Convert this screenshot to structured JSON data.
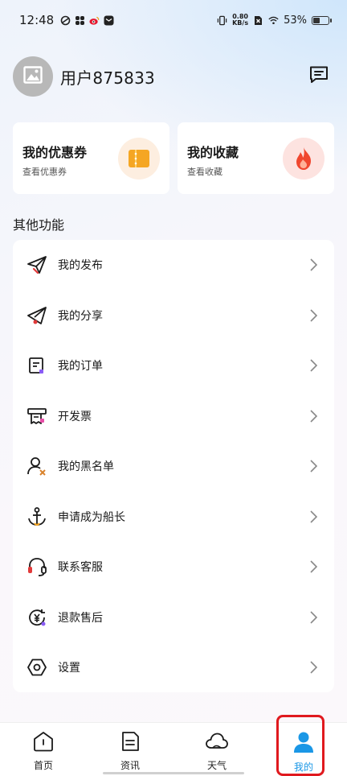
{
  "status_bar": {
    "time": "12:48",
    "net_speed_value": "0.80",
    "net_speed_unit": "KB/s",
    "battery_percent": "53%",
    "battery_level": 0.53,
    "left_icons": [
      "sync-icon",
      "pinwheel-icon",
      "weibo-icon",
      "message-app-icon"
    ],
    "right_icons": [
      "vibrate-icon",
      "no-sim-icon",
      "wifi-icon",
      "battery-icon"
    ]
  },
  "profile": {
    "username": "用户875833",
    "avatar_icon": "image-placeholder-icon",
    "message_icon": "message-icon"
  },
  "cards": [
    {
      "title": "我的优惠券",
      "subtitle": "查看优惠券",
      "icon": "coupon-icon",
      "color": "#f5a623"
    },
    {
      "title": "我的收藏",
      "subtitle": "查看收藏",
      "icon": "flame-icon",
      "color": "#f0472f"
    }
  ],
  "section_title": "其他功能",
  "menu": [
    {
      "label": "我的发布",
      "icon": "paper-plane-icon"
    },
    {
      "label": "我的分享",
      "icon": "share-plane-icon"
    },
    {
      "label": "我的订单",
      "icon": "order-list-icon"
    },
    {
      "label": "开发票",
      "icon": "invoice-icon"
    },
    {
      "label": "我的黑名单",
      "icon": "user-block-icon"
    },
    {
      "label": "申请成为船长",
      "icon": "anchor-icon"
    },
    {
      "label": "联系客服",
      "icon": "headset-icon"
    },
    {
      "label": "退款售后",
      "icon": "refund-yen-icon"
    },
    {
      "label": "设置",
      "icon": "settings-hexagon-icon"
    }
  ],
  "tabbar": {
    "tabs": [
      {
        "label": "首页",
        "icon": "home-icon"
      },
      {
        "label": "资讯",
        "icon": "news-icon"
      },
      {
        "label": "天气",
        "icon": "cloud-icon"
      },
      {
        "label": "我的",
        "icon": "profile-icon"
      }
    ],
    "active_index": 3
  },
  "colors": {
    "accent_blue": "#1a97e6",
    "highlight_red": "#e0191e",
    "icon_red": "#e23a3a",
    "icon_orange": "#f5a623",
    "icon_purple": "#8a5cf5"
  }
}
